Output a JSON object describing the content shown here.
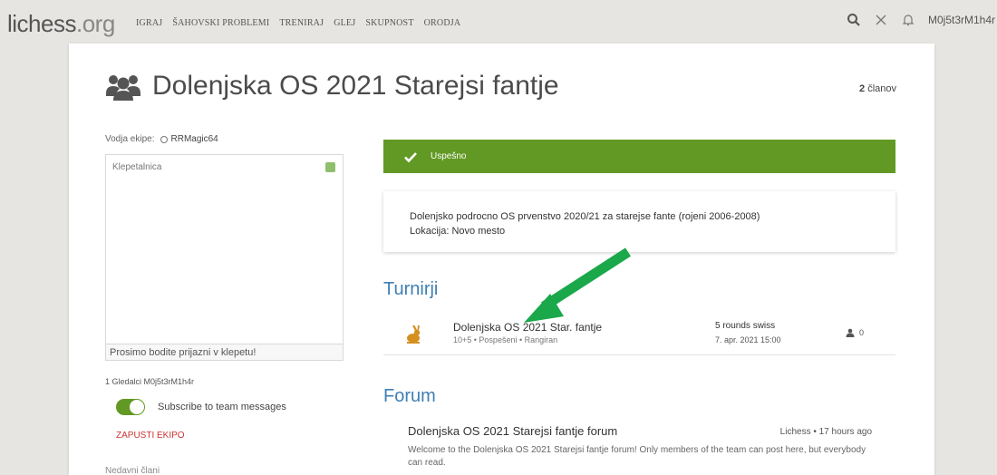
{
  "logo": {
    "name": "lichess",
    "tld": ".org"
  },
  "nav": [
    "IGRAJ",
    "ŠAHOVSKI PROBLEMI",
    "TRENIRAJ",
    "GLEJ",
    "SKUPNOST",
    "ORODJA"
  ],
  "topbar": {
    "username": "M0j5t3rM1h4r"
  },
  "team": {
    "title": "Dolenjska OS 2021 Starejsi fantje",
    "members_number": "2",
    "members_label": "članov",
    "leader_label": "Vodja ekipe:",
    "leader_name": "RRMagic64"
  },
  "chat": {
    "title": "Klepetalnica",
    "input_placeholder": "Prosimo bodite prijazni v klepetu!"
  },
  "sidebar": {
    "watchers": "1 Gledalci M0j5t3rM1h4r",
    "subscribe_label": "Subscribe to team messages",
    "quit_label": "ZAPUSTI EKIPO",
    "recent_members": "Nedavni člani"
  },
  "success": {
    "text": "Uspešno"
  },
  "description": {
    "line1": "Dolenjsko podrocno OS prvenstvo 2020/21 za starejse fante (rojeni 2006-2008)",
    "line2": "Lokacija: Novo mesto"
  },
  "tournaments": {
    "title": "Turnirji",
    "items": [
      {
        "name": "Dolenjska OS 2021 Star. fantje",
        "meta": "10+5 • Pospešeni • Rangiran",
        "format": "5 rounds swiss",
        "date": "7. apr. 2021 15:00",
        "players": "0"
      }
    ]
  },
  "forum": {
    "title": "Forum",
    "items": [
      {
        "name": "Dolenjska OS 2021 Starejsi fantje forum",
        "author": "Lichess • 17 hours ago",
        "description": "Welcome to the Dolenjska OS 2021 Starejsi fantje forum! Only members of the team can post here, but everybody can read."
      }
    ]
  },
  "colors": {
    "accent_green": "#629924",
    "link_blue": "#3f7fb5",
    "annotation_arrow": "#1aa84a",
    "danger_red": "#cc3333"
  }
}
